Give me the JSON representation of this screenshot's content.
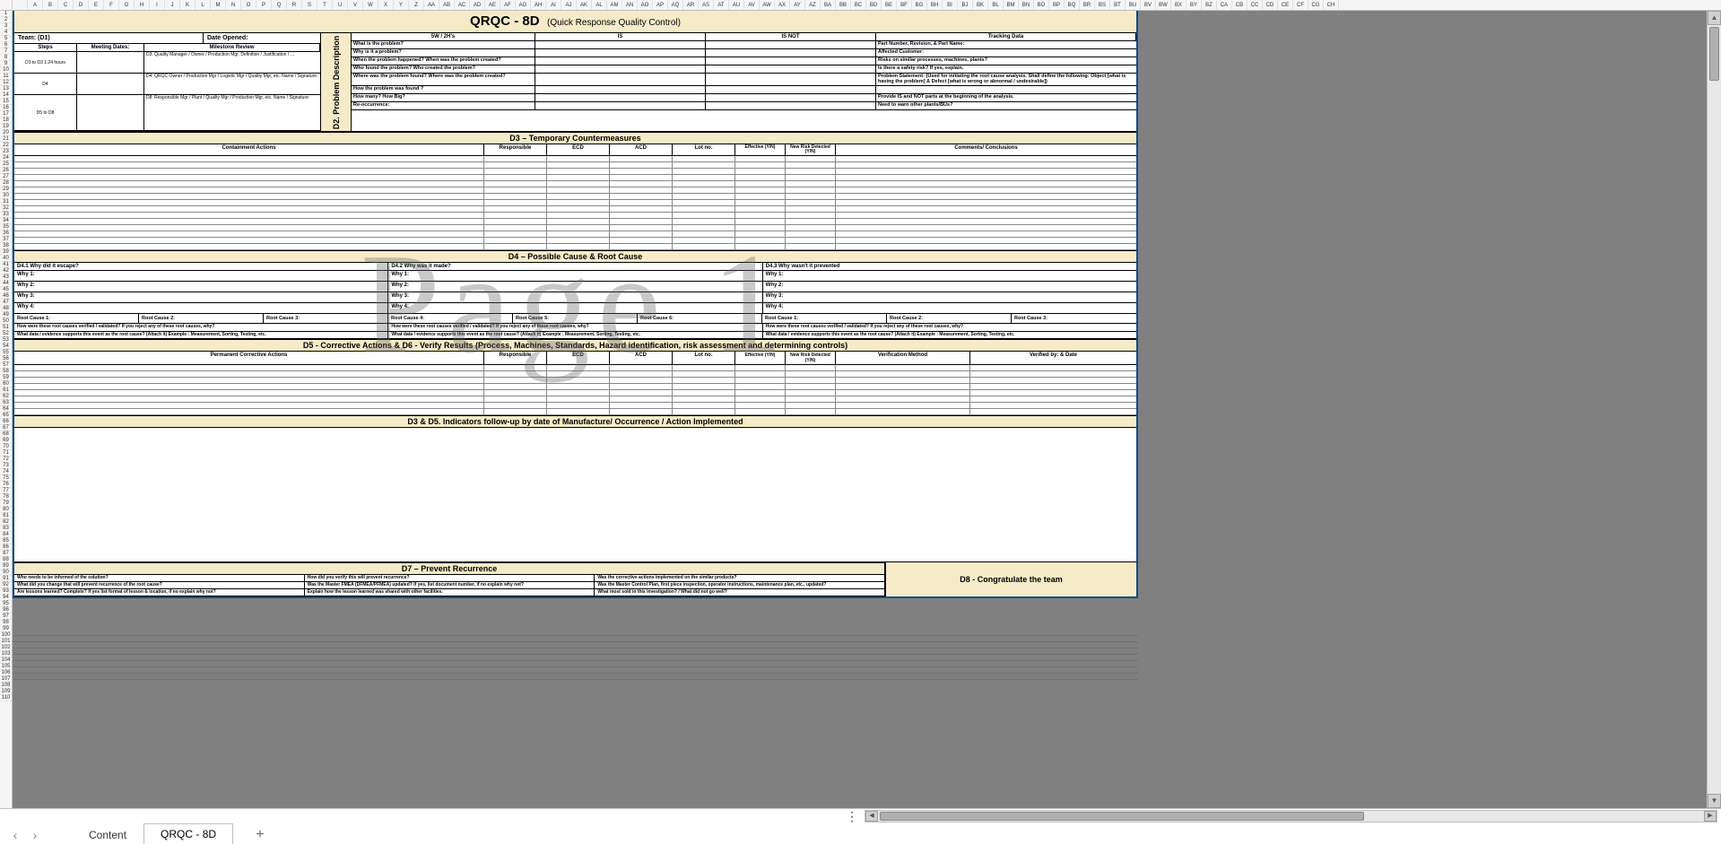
{
  "cols": [
    "",
    "A",
    "B",
    "C",
    "D",
    "E",
    "F",
    "G",
    "H",
    "I",
    "J",
    "K",
    "L",
    "M",
    "N",
    "O",
    "P",
    "Q",
    "R",
    "S",
    "T",
    "U",
    "V",
    "W",
    "X",
    "Y",
    "Z",
    "AA",
    "AB",
    "AC",
    "AD",
    "AE",
    "AF",
    "AG",
    "AH",
    "AI",
    "AJ",
    "AK",
    "AL",
    "AM",
    "AN",
    "AO",
    "AP",
    "AQ",
    "AR",
    "AS",
    "AT",
    "AU",
    "AV",
    "AW",
    "AX",
    "AY",
    "AZ",
    "BA",
    "BB",
    "BC",
    "BD",
    "BE",
    "BF",
    "BG",
    "BH",
    "BI",
    "BJ",
    "BK",
    "BL",
    "BM",
    "BN",
    "BO",
    "BP",
    "BQ",
    "BR",
    "BS",
    "BT",
    "BU",
    "BV",
    "BW",
    "BX",
    "BY",
    "BZ",
    "CA",
    "CB",
    "CC",
    "CD",
    "CE",
    "CF",
    "CG",
    "CH"
  ],
  "title": {
    "main": "QRQC - 8D",
    "sub": "(Quick Response Quality Control)"
  },
  "d1": {
    "team": "Team: (D1)",
    "dateOpened": "Date Opened:",
    "cols": {
      "steps": "Steps",
      "dates": "Meeting Dates:",
      "mr": "Milestone Review"
    },
    "rows": [
      {
        "step": "D1 to D3\n1:24 hours",
        "mr": "D3: Quality Manager / Owner / Production Mgr.\nDefinition / Justification / …"
      },
      {
        "step": "D4",
        "mr": "D4: QRQC Owner / Production Mgr / Logistic Mgr / Quality Mgr, etc.\nName / Signature:"
      },
      {
        "step": "D5 to D8",
        "mr": "D8: Responsible Mgr / Plant / Quality Mgr / Production Mgr, etc.\nName / Signature:"
      }
    ]
  },
  "d2": {
    "side": "D2. Problem Description",
    "hdrs": {
      "q": "5W / 2H's",
      "is": "IS",
      "isnot": "IS NOT",
      "trk": "Tracking Data"
    },
    "rows": [
      {
        "q": "What is the problem?",
        "t": "Part Number, Revision, & Part Name:"
      },
      {
        "q": "Why is it a problem?",
        "t": "Affected Customer:"
      },
      {
        "q": "When the problem happened?\nWhen was the problem created?",
        "t": "Risks on similar processes, machines, plants?"
      },
      {
        "q": "Who found the problem?\nWho created the problem?",
        "t": "Is there a safety risk? If yes, explain."
      },
      {
        "q": "Where was the problem found?  Where was the problem created?",
        "t": "Problem Statement: (Used for initiating the root cause analysis. Shall define the following:\nObject [what is having the problem] & Defect [what is wrong or abnormal / undesirable])"
      },
      {
        "q": "How the problem was found ?",
        "t": ""
      },
      {
        "q": "How many? How Big?",
        "t": "Provide IS and NOT parts at the beginning of the analysis."
      },
      {
        "q": "Re-occurrence:",
        "t": "Need to warn other plants/BUs?"
      }
    ]
  },
  "d3": {
    "title": "D3 – Temporary Countermeasures",
    "cols": {
      "ca": "Containment Actions",
      "rp": "Responsible",
      "ec": "ECD",
      "ac": "ACD",
      "ln": "Lot no.",
      "ef": "Effective\n(Y/N)",
      "nr": "New Risk Detected\n(Y/N)",
      "cc": "Comments/ Conclusions"
    }
  },
  "d4": {
    "title": "D4 – Possible Cause & Root Cause",
    "heads": [
      "D4.1 Why did it escape?",
      "D4.2 Why was it made?",
      "D4.3 Why wasn't it prevented"
    ],
    "whys": [
      "Why 1:",
      "Why 2:",
      "Why 3:",
      "Why 4:"
    ],
    "roots": [
      "Root Cause 1:",
      "Root Cause 2:",
      "Root Cause 3:",
      "Root Cause 4:",
      "Root Cause 5:",
      "Root Cause 6:",
      "Root Cause 1:",
      "Root Cause 2:",
      "Root Cause 3:"
    ],
    "q1": "How were these root causes verified / validated?  If you reject any of these root causes, why?",
    "q2": "What data / evidence supports this event as the root cause? (Attach it)\nExample : Measurement, Sorting, Testing, etc."
  },
  "d5": {
    "title": "D5 - Corrective Actions &  D6 - Verify Results (Process, Machines, Standards, Hazard identification, risk assessment and determining controls)",
    "cols": {
      "pc": "Permanent Corrective Actions",
      "rp": "Responsible",
      "ec": "ECD",
      "ac": "ACD",
      "ln": "Lot no.",
      "ef": "Effective\n(Y/N)",
      "nr": "New Risk Detected\n(Y/N)",
      "vm": "Verification Method",
      "vb": "Verified by:  & Date"
    }
  },
  "ind": {
    "title": "D3 & D5. Indicators follow-up by date of Manufacture/ Occurrence / Action Implemented"
  },
  "d7": {
    "title": "D7 – Prevent Recurrence",
    "rows": [
      [
        "Who needs to be informed of the solution?",
        "How did you verify this will prevent recurrence?",
        "Was the corrective actions implemented on the similar products?"
      ],
      [
        "What did you change that will prevent recurrence of the root cause?",
        "Was the Master FMEA (DFMEA/PFMEA) updated? If yes, list document number, if no explain why not?",
        "Was the Master Control Plan, first piece inspection, operator instructions, maintenance plan, etc., updated?"
      ],
      [
        "Are lessons learned? Complete? If yes list format of lesson & location, if no explain why not?",
        "Explain how the lesson learned was shared with other facilities.",
        "What most sold in this investigation? / What did not go well?"
      ]
    ]
  },
  "d8": {
    "title": "D8 - Congratulate the team"
  },
  "tabs": {
    "t1": "Content",
    "t2": "QRQC - 8D"
  },
  "watermark": "Page 1"
}
